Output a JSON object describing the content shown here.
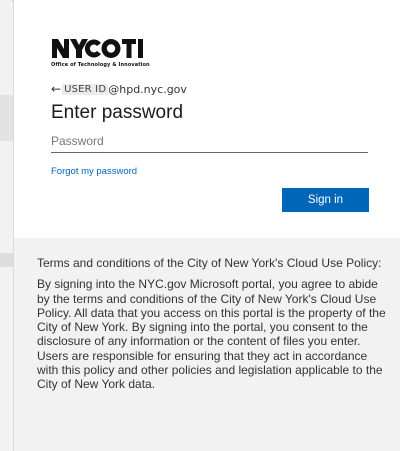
{
  "header": {
    "logo_text": "NYC OTI",
    "logo_caption": "Office of Technology & Innovation"
  },
  "account": {
    "back_arrow": "←",
    "user_id": "USER ID",
    "email_domain": "@hpd.nyc.gov"
  },
  "form": {
    "title": "Enter password",
    "password_placeholder": "Password",
    "password_value": "",
    "forgot_link": "Forgot my password",
    "signin_label": "Sign in"
  },
  "terms": {
    "heading": "Terms and conditions of the City of New York's Cloud Use Policy:",
    "body": "By signing into the NYC.gov Microsoft portal, you agree to abide by the terms and conditions of the City of New York's Cloud Use Policy. All data that you access on this portal is the property of the City of New York. By signing into the portal, you consent to the disclosure of any information or the content of files you enter. Users are responsible for ensuring that they act in accordance with this policy and other policies and legislation applicable to the City of New York data."
  },
  "colors": {
    "accent": "#0067b8",
    "terms_background": "#f2f2f2"
  }
}
